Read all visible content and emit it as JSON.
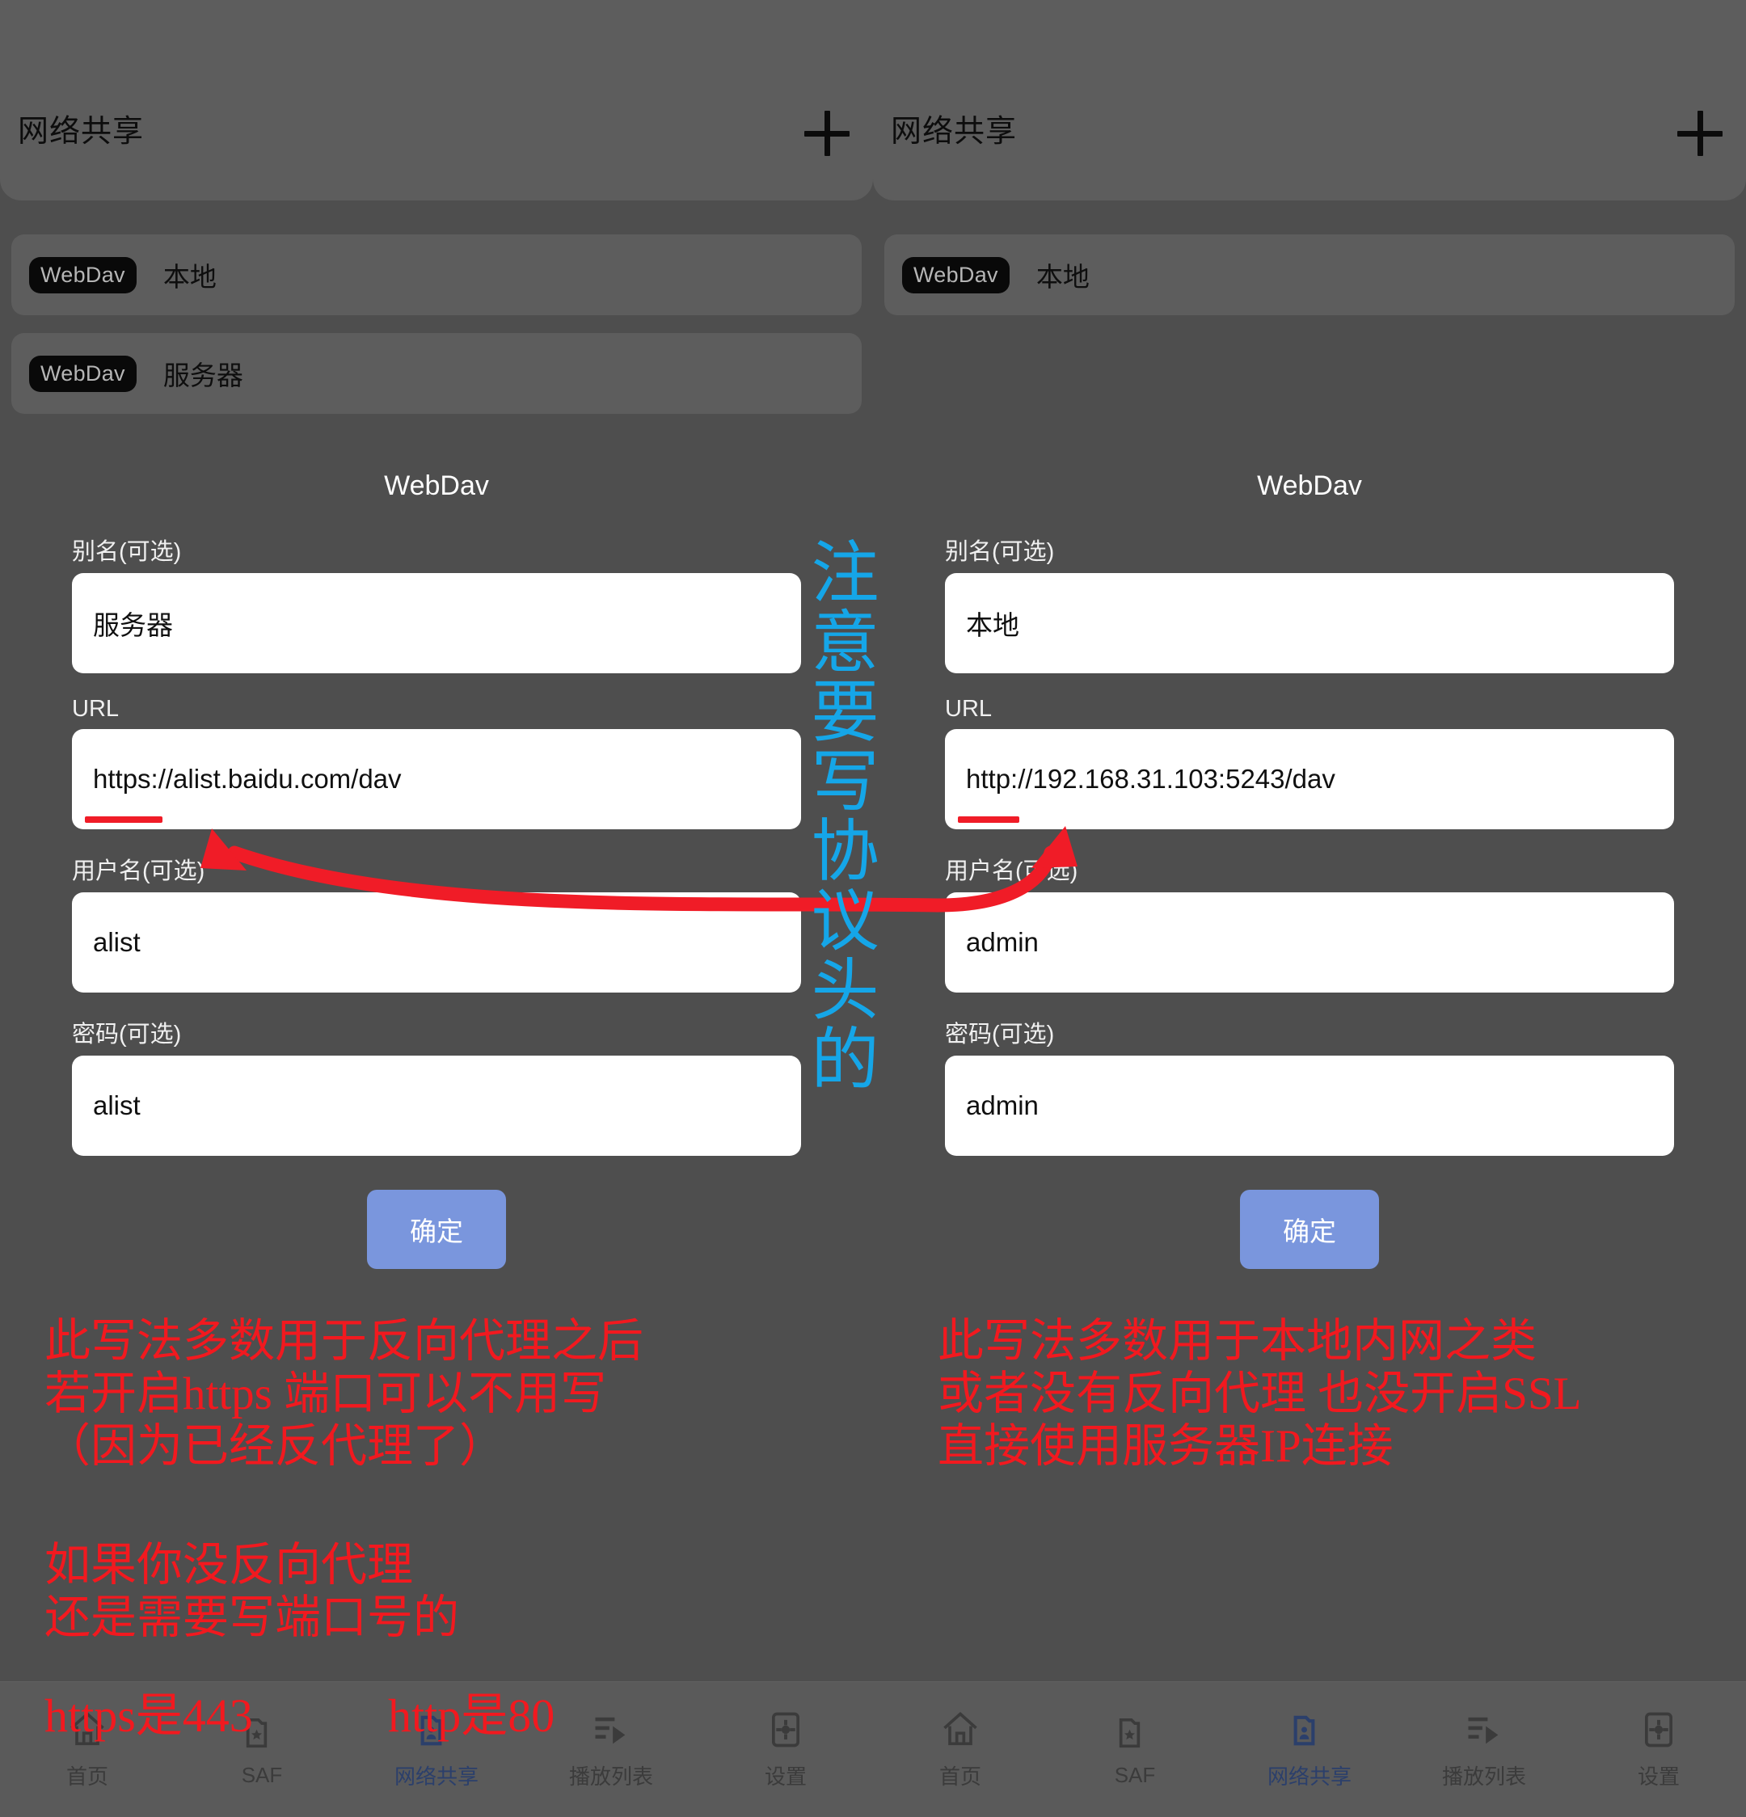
{
  "app": {
    "bar_title": "网络共享",
    "add_icon": "plus-icon"
  },
  "panels": [
    {
      "id": "left",
      "share_list": [
        {
          "badge": "WebDav",
          "name": "本地"
        },
        {
          "badge": "WebDav",
          "name": "服务器"
        }
      ],
      "form": {
        "title": "WebDav",
        "fields": [
          {
            "label": "别名(可选)",
            "value": "服务器",
            "placeholder": "别名(可选)",
            "underline": false
          },
          {
            "label": "URL",
            "value": "https://alist.baidu.com/dav",
            "placeholder": "URL",
            "underline": true,
            "underline_width": 96
          },
          {
            "label": "用户名(可选)",
            "value": "alist",
            "placeholder": "用户名(可选)",
            "underline": false
          },
          {
            "label": "密码(可选)",
            "value": "alist",
            "placeholder": "密码(可选)",
            "underline": false
          }
        ],
        "confirm_label": "确定"
      }
    },
    {
      "id": "right",
      "share_list": [
        {
          "badge": "WebDav",
          "name": "本地"
        }
      ],
      "form": {
        "title": "WebDav",
        "fields": [
          {
            "label": "别名(可选)",
            "value": "本地",
            "placeholder": "别名(可选)",
            "underline": false
          },
          {
            "label": "URL",
            "value": "http://192.168.31.103:5243/dav",
            "placeholder": "URL",
            "underline": true,
            "underline_width": 76
          },
          {
            "label": "用户名(可选)",
            "value": "admin",
            "placeholder": "用户名(可选)",
            "underline": false
          },
          {
            "label": "密码(可选)",
            "value": "admin",
            "placeholder": "密码(可选)",
            "underline": false
          }
        ],
        "confirm_label": "确定"
      }
    }
  ],
  "bottom_nav": {
    "active_index": 2,
    "items": [
      {
        "label": "首页",
        "icon": "home-icon"
      },
      {
        "label": "SAF",
        "icon": "folder-star-icon"
      },
      {
        "label": "网络共享",
        "icon": "folder-user-icon"
      },
      {
        "label": "播放列表",
        "icon": "playlist-icon"
      },
      {
        "label": "设置",
        "icon": "settings-gear-icon"
      }
    ]
  },
  "annotations": {
    "vertical_note": "注意要写协议头的",
    "left_note_1": "此写法多数用于反向代理之后\n若开启https  端口可以不用写\n（因为已经反代理了）",
    "left_note_2": "如果你没反向代理\n还是需要写端口号的",
    "left_note_3": "https是443",
    "left_note_port_http": "http是80",
    "right_note_1": "此写法多数用于本地内网之类\n或者没有反向代理  也没开启SSL\n直接使用服务器IP连接"
  },
  "colors": {
    "background": "#4e4e4e",
    "card": "#5d5d5d",
    "accent_button": "#7a96dd",
    "annotation_red": "#f2191f",
    "annotation_cyan": "#15a6e8",
    "nav_active": "#2b3f6b",
    "chip": "#090909"
  }
}
